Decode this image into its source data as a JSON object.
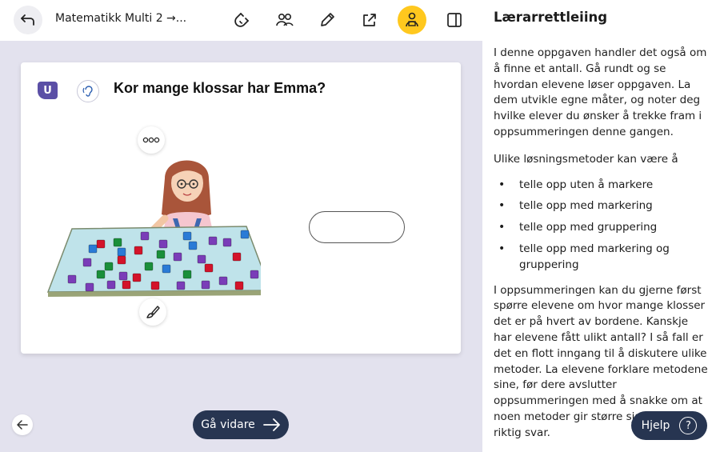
{
  "header": {
    "title": "Matematikk Multi 2 →...",
    "icons": [
      "back-arrow-icon",
      "magnet-icon",
      "users-icon",
      "pencil-icon",
      "share-icon",
      "teacher-icon",
      "sidebar-toggle-icon"
    ],
    "active_color": "#ffc81e"
  },
  "task": {
    "badge": "U",
    "question": "Kor mange klossar har Emma?",
    "answer_value": "",
    "more_icon": "more-dots-icon",
    "draw_icon": "paintbrush-icon"
  },
  "footer": {
    "next_label": "Gå vidare"
  },
  "teacher_panel": {
    "title": "Lærarrettleiing",
    "intro": "I denne oppgaven handler det også om å finne et antall. Gå rundt og se hvordan elevene løser oppgaven. La dem utvikle egne måter, og noter deg hvilke elever du ønsker å trekke fram i oppsummeringen denne gangen.",
    "methods_heading": "Ulike løsningsmetoder kan være å",
    "methods": [
      "telle opp uten å markere",
      "telle opp med markering",
      "telle opp med gruppering",
      "telle opp med markering og gruppering"
    ],
    "summary": "I oppsummeringen kan du gjerne først spørre elevene om hvor mange klosser det er på hvert av bordene. Kanskje har elevene fått ulikt antall? I så fall er det en flott inngang til å diskutere ulike metoder. La elevene forklare metodene sine, før dere avslutter oppsummeringen med å snakke om at noen metoder gir større sjanse for riktig svar.",
    "help_label": "Hjelp",
    "help_symbol": "?"
  },
  "colors": {
    "nav_dark": "#273551",
    "badge_purple": "#5b4fa6",
    "table_top": "#bfe3ea",
    "cube_colors": [
      "#d3142a",
      "#1a8f3a",
      "#7a3db8",
      "#2a7bd6"
    ]
  }
}
